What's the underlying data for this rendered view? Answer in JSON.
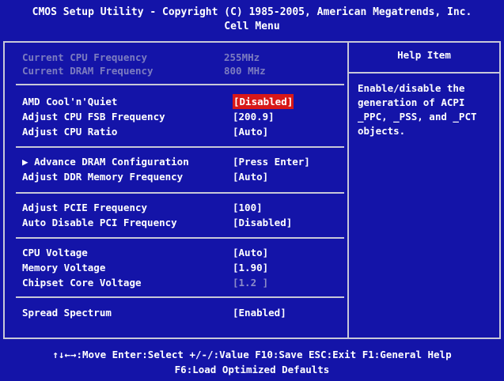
{
  "title": {
    "line1": "CMOS Setup Utility - Copyright (C) 1985-2005, American Megatrends, Inc.",
    "line2": "Cell Menu"
  },
  "info": [
    {
      "label": "Current CPU Frequency",
      "value": "255MHz"
    },
    {
      "label": "Current DRAM Frequency",
      "value": "800 MHz"
    }
  ],
  "settings": {
    "cool_n_quiet": {
      "label": "AMD Cool'n'Quiet",
      "value": "[Disabled]"
    },
    "fsb_frequency": {
      "label": "Adjust CPU FSB Frequency",
      "value": "[200.9]"
    },
    "cpu_ratio": {
      "label": "Adjust CPU Ratio",
      "value": "[Auto]"
    },
    "dram_config": {
      "label": "Advance DRAM Configuration",
      "value": "[Press Enter]",
      "marker": "▶"
    },
    "ddr_frequency": {
      "label": "Adjust DDR Memory Frequency",
      "value": "[Auto]"
    },
    "pcie_frequency": {
      "label": "Adjust PCIE Frequency",
      "value": "[100]"
    },
    "auto_disable_pci": {
      "label": "Auto Disable PCI Frequency",
      "value": "[Disabled]"
    },
    "cpu_voltage": {
      "label": "CPU Voltage",
      "value": "[Auto]"
    },
    "memory_voltage": {
      "label": "Memory Voltage",
      "value": "[1.90]"
    },
    "chipset_voltage": {
      "label": "Chipset Core Voltage",
      "value": "[1.2 ]"
    },
    "spread_spectrum": {
      "label": "Spread Spectrum",
      "value": "[Enabled]"
    }
  },
  "help": {
    "title": "Help Item",
    "text": "Enable/disable the\ngeneration of ACPI\n_PPC, _PSS, and _PCT\nobjects."
  },
  "footer": {
    "line1": "↑↓←→:Move  Enter:Select  +/-/:Value  F10:Save  ESC:Exit  F1:General Help",
    "line2": "F6:Load Optimized Defaults"
  },
  "colors": {
    "background": "#1414a8",
    "highlight": "#d81818",
    "text": "#ffffff",
    "dim_text": "#7c7cc0"
  }
}
